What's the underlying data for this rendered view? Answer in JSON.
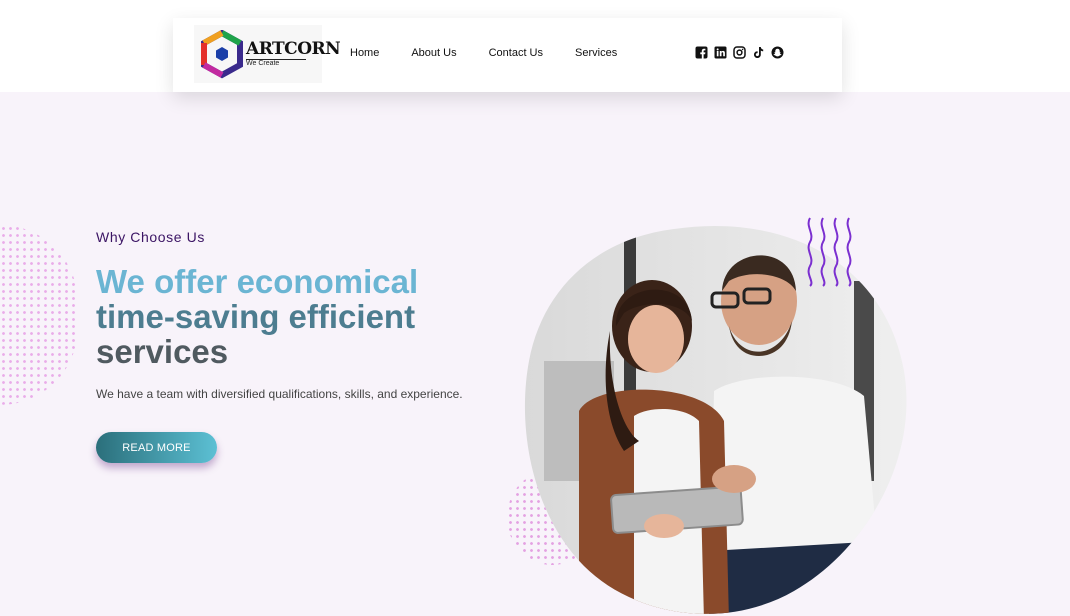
{
  "header": {
    "logo": {
      "name": "ARTCORN",
      "tagline": "We Create"
    },
    "nav": [
      {
        "label": "Home"
      },
      {
        "label": "About Us"
      },
      {
        "label": "Contact Us"
      },
      {
        "label": "Services"
      }
    ],
    "social_icons": [
      "facebook-icon",
      "linkedin-icon",
      "instagram-icon",
      "tiktok-icon",
      "snapchat-icon"
    ]
  },
  "hero": {
    "eyebrow": "Why Choose Us",
    "headline": {
      "line1": "We offer economical",
      "line2": "time-saving efficient",
      "line3": "services"
    },
    "subtext": "We have a team with diversified qualifications, skills, and experience.",
    "cta_label": "READ MORE"
  },
  "colors": {
    "hero_bg": "#f8f3fa",
    "eyebrow": "#3b1464",
    "headline_1": "#6bb5d3",
    "headline_2": "#4d7d90",
    "headline_3": "#505a60",
    "cta_start": "#2b6f7b",
    "cta_end": "#5cc0d4",
    "accent_purple": "#7b2fd0"
  }
}
